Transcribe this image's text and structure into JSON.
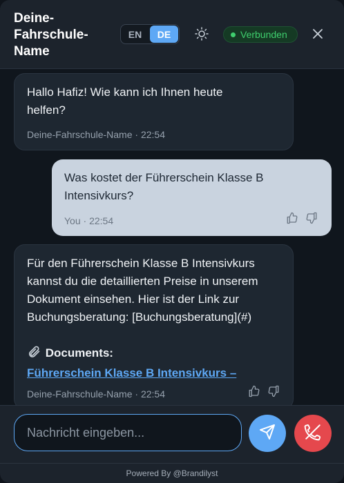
{
  "header": {
    "title": "Deine-\nFahrschule-\nName",
    "lang_en": "EN",
    "lang_de": "DE",
    "active_lang": "DE",
    "theme_icon": "sun-icon",
    "status": "Verbunden",
    "close_icon": "close-icon"
  },
  "messages": [
    {
      "role": "bot",
      "text": "Hallo Hafiz! Wie kann ich Ihnen heute\nhelfen?",
      "meta": "Deine-Fahrschule-Name · 22:54"
    },
    {
      "role": "user",
      "text": "Was kostet der Führerschein Klasse B\nIntensivkurs?",
      "meta": "You · 22:54"
    },
    {
      "role": "bot",
      "text": "Für den Führerschein Klasse B Intensivkurs\nkannst du die detaillierten Preise in unserem\nDokument einsehen. Hier ist der Link zur\nBuchungsberatung: [Buchungsberatung](#)",
      "documents_label": "Documents:",
      "document_link": "Führerschein Klasse B Intensivkurs –",
      "meta": "Deine-Fahrschule-Name · 22:54"
    }
  ],
  "input": {
    "placeholder": "Nachricht eingeben..."
  },
  "footer": {
    "powered_by": "Powered By @Brandilyst"
  },
  "colors": {
    "accent": "#5ea8f5",
    "status_green": "#3fcf6e",
    "hangup_red": "#e5484d"
  }
}
